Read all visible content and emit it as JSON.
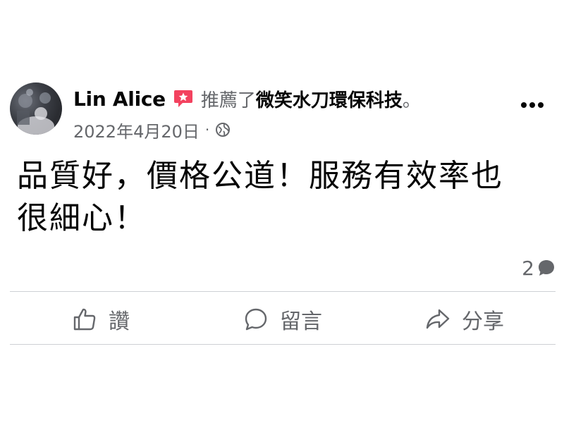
{
  "post": {
    "author": "Lin Alice",
    "recommend_text": "推薦了",
    "page_name": "微笑水刀環保科技",
    "period": "。",
    "date": "2022年4月20日",
    "date_separator": "·",
    "body_text": "品質好，價格公道！服務有效率也很細心！",
    "comment_count": "2"
  },
  "actions": {
    "like_label": "讚",
    "comment_label": "留言",
    "share_label": "分享"
  },
  "icons": {
    "recommend": "recommend-star-icon",
    "privacy": "globe-icon",
    "more": "ellipsis-icon",
    "comment_bubble": "comment-bubble-icon",
    "like": "thumbs-up-icon",
    "comment": "comment-icon",
    "share": "share-arrow-icon"
  },
  "colors": {
    "text_primary": "#050505",
    "text_secondary": "#65676b",
    "recommend_badge": "#f3425f",
    "divider": "#ced0d4"
  }
}
